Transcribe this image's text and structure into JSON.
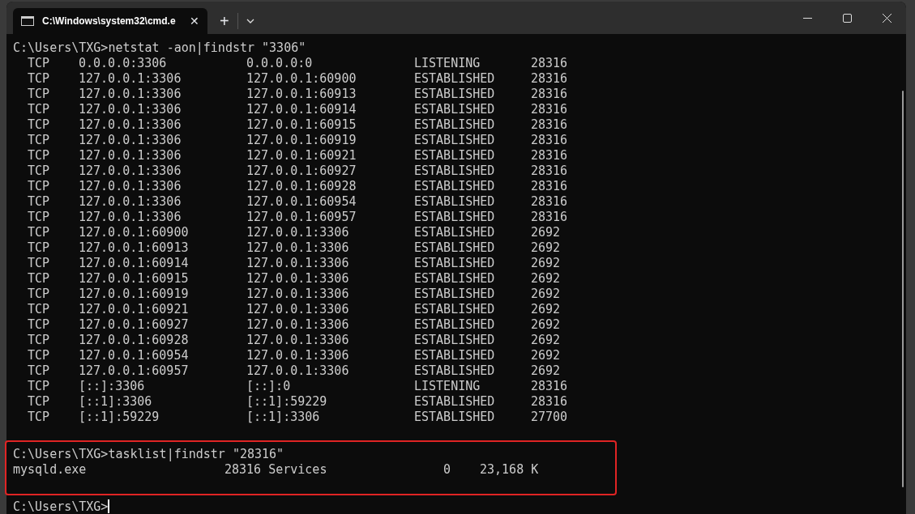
{
  "window": {
    "tab_title": "C:\\Windows\\system32\\cmd.e",
    "tab_close": "✕",
    "new_tab": "+"
  },
  "commands": [
    {
      "prompt": "C:\\Users\\TXG>",
      "command": "netstat -aon|findstr \"3306\"",
      "highlighted": false,
      "kind": "table",
      "rows": [
        [
          "TCP",
          "0.0.0.0:3306",
          "0.0.0.0:0",
          "LISTENING",
          "28316"
        ],
        [
          "TCP",
          "127.0.0.1:3306",
          "127.0.0.1:60900",
          "ESTABLISHED",
          "28316"
        ],
        [
          "TCP",
          "127.0.0.1:3306",
          "127.0.0.1:60913",
          "ESTABLISHED",
          "28316"
        ],
        [
          "TCP",
          "127.0.0.1:3306",
          "127.0.0.1:60914",
          "ESTABLISHED",
          "28316"
        ],
        [
          "TCP",
          "127.0.0.1:3306",
          "127.0.0.1:60915",
          "ESTABLISHED",
          "28316"
        ],
        [
          "TCP",
          "127.0.0.1:3306",
          "127.0.0.1:60919",
          "ESTABLISHED",
          "28316"
        ],
        [
          "TCP",
          "127.0.0.1:3306",
          "127.0.0.1:60921",
          "ESTABLISHED",
          "28316"
        ],
        [
          "TCP",
          "127.0.0.1:3306",
          "127.0.0.1:60927",
          "ESTABLISHED",
          "28316"
        ],
        [
          "TCP",
          "127.0.0.1:3306",
          "127.0.0.1:60928",
          "ESTABLISHED",
          "28316"
        ],
        [
          "TCP",
          "127.0.0.1:3306",
          "127.0.0.1:60954",
          "ESTABLISHED",
          "28316"
        ],
        [
          "TCP",
          "127.0.0.1:3306",
          "127.0.0.1:60957",
          "ESTABLISHED",
          "28316"
        ],
        [
          "TCP",
          "127.0.0.1:60900",
          "127.0.0.1:3306",
          "ESTABLISHED",
          "2692"
        ],
        [
          "TCP",
          "127.0.0.1:60913",
          "127.0.0.1:3306",
          "ESTABLISHED",
          "2692"
        ],
        [
          "TCP",
          "127.0.0.1:60914",
          "127.0.0.1:3306",
          "ESTABLISHED",
          "2692"
        ],
        [
          "TCP",
          "127.0.0.1:60915",
          "127.0.0.1:3306",
          "ESTABLISHED",
          "2692"
        ],
        [
          "TCP",
          "127.0.0.1:60919",
          "127.0.0.1:3306",
          "ESTABLISHED",
          "2692"
        ],
        [
          "TCP",
          "127.0.0.1:60921",
          "127.0.0.1:3306",
          "ESTABLISHED",
          "2692"
        ],
        [
          "TCP",
          "127.0.0.1:60927",
          "127.0.0.1:3306",
          "ESTABLISHED",
          "2692"
        ],
        [
          "TCP",
          "127.0.0.1:60928",
          "127.0.0.1:3306",
          "ESTABLISHED",
          "2692"
        ],
        [
          "TCP",
          "127.0.0.1:60954",
          "127.0.0.1:3306",
          "ESTABLISHED",
          "2692"
        ],
        [
          "TCP",
          "127.0.0.1:60957",
          "127.0.0.1:3306",
          "ESTABLISHED",
          "2692"
        ],
        [
          "TCP",
          "[::]:3306",
          "[::]:0",
          "LISTENING",
          "28316"
        ],
        [
          "TCP",
          "[::1]:3306",
          "[::1]:59229",
          "ESTABLISHED",
          "28316"
        ],
        [
          "TCP",
          "[::1]:59229",
          "[::1]:3306",
          "ESTABLISHED",
          "27700"
        ]
      ]
    },
    {
      "prompt": "C:\\Users\\TXG>",
      "command": "tasklist|findstr \"28316\"",
      "highlighted": true,
      "kind": "list",
      "rows": [
        [
          "mysqld.exe",
          "28316 Services",
          "0",
          "23,168 K"
        ]
      ]
    }
  ],
  "final_prompt": "C:\\Users\\TXG>"
}
